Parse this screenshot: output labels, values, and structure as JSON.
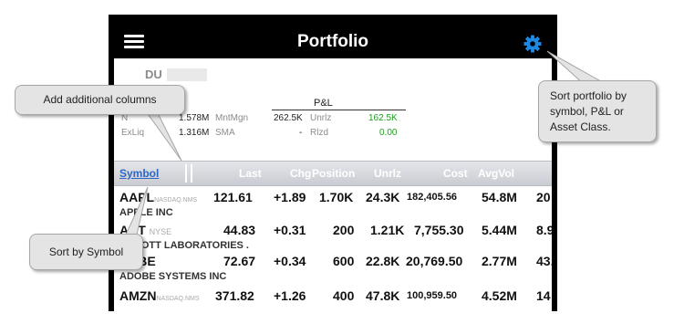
{
  "navbar": {
    "title": "Portfolio",
    "menu_icon": "hamburger-menu-icon",
    "settings_icon": "gear-icon",
    "accent": "#1e88e5"
  },
  "account": {
    "id": "DU"
  },
  "metrics": {
    "pl_header": "P&L",
    "rows": [
      {
        "label1": "N",
        "value1": "1.578M",
        "label2": "MntMgn",
        "value2": "262.5K",
        "label3": "Unrlz",
        "value3": "162.5K"
      },
      {
        "label1": "ExLiq",
        "value1": "1.316M",
        "label2": "SMA",
        "value2": "-",
        "label3": "Rlzd",
        "value3": "0.00"
      }
    ]
  },
  "table": {
    "headers": {
      "symbol": "Symbol",
      "last": "Last",
      "chg": "Chg",
      "position": "Position",
      "unrlz": "Unrlz",
      "cost": "Cost",
      "avgvol": "AvgVol"
    },
    "rows": [
      {
        "symbol": "AAPL",
        "exchange": "NASDAQ.NMS",
        "name": "APPLE INC",
        "last": "121.61",
        "chg": "+1.89",
        "position": "1.70K",
        "unrlz": "24.3K",
        "cost": "182,405.56",
        "avgvol": "54.8M",
        "extra": "20"
      },
      {
        "symbol": "ABT",
        "exchange": "NYSE",
        "name": "ABBOTT LABORATORIES .",
        "last": "44.83",
        "chg": "+0.31",
        "position": "200",
        "unrlz": "1.21K",
        "cost": "7,755.30",
        "avgvol": "5.44M",
        "extra": "8.9"
      },
      {
        "symbol": "ADBE",
        "exchange": "NASDAQ.NMS",
        "name": "ADOBE SYSTEMS INC",
        "last": "72.67",
        "chg": "+0.34",
        "position": "600",
        "unrlz": "22.8K",
        "cost": "20,769.50",
        "avgvol": "2.77M",
        "extra": "43."
      },
      {
        "symbol": "AMZN",
        "exchange": "NASDAQ.NMS",
        "name": "",
        "last": "371.82",
        "chg": "+1.26",
        "position": "400",
        "unrlz": "47.8K",
        "cost": "100,959.50",
        "avgvol": "4.52M",
        "extra": "14"
      }
    ]
  },
  "callouts": {
    "add_columns": "Add additional columns",
    "sort_symbol": "Sort by Symbol",
    "sort_portfolio": [
      "Sort portfolio by",
      "symbol, P&L or",
      "Asset Class."
    ]
  }
}
